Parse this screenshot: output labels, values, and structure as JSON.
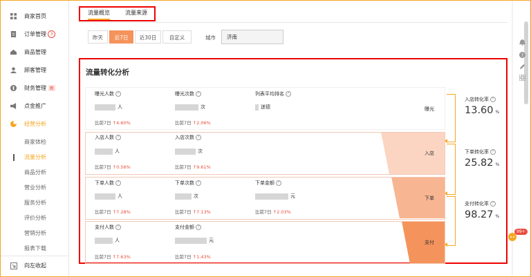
{
  "sidebar": {
    "items": [
      {
        "label": "商家首页",
        "icon": "grid-icon"
      },
      {
        "label": "订单管理",
        "icon": "order-icon",
        "badge": "3"
      },
      {
        "label": "商品管理",
        "icon": "goods-icon"
      },
      {
        "label": "顾客管理",
        "icon": "user-icon"
      },
      {
        "label": "财务管理",
        "icon": "finance-icon",
        "badge": "新"
      },
      {
        "label": "点金推广",
        "icon": "megaphone-icon"
      },
      {
        "label": "经营分析",
        "icon": "pie-chart-icon"
      }
    ],
    "subitems": [
      "商家体检",
      "流量分析",
      "商品分析",
      "营业分析",
      "服务分析",
      "评价分析",
      "营销分析",
      "报表下载"
    ],
    "collapse_label": "向左收起"
  },
  "tabs": [
    "流量概览",
    "流量来源"
  ],
  "date_filter": {
    "options": [
      "昨天",
      "近7日",
      "近30日",
      "自定义"
    ],
    "selected": "近7日"
  },
  "city": {
    "label": "城市",
    "value": "济南"
  },
  "panel": {
    "title": "流量转化分析",
    "rows": [
      {
        "funnel_label": "曝光",
        "metrics": [
          {
            "label": "曝光人数",
            "unit": "人",
            "compare_prefix": "比前7日",
            "compare": "4.60%"
          },
          {
            "label": "曝光次数",
            "unit": "次",
            "compare_prefix": "比前7日",
            "compare": "2.06%"
          },
          {
            "label": "列表平均排名",
            "unit": "迷德"
          }
        ]
      },
      {
        "funnel_label": "入店",
        "metrics": [
          {
            "label": "入店人数",
            "unit": "人",
            "compare_prefix": "比前7日",
            "compare": "0.56%"
          },
          {
            "label": "入店次数",
            "unit": "次",
            "compare_prefix": "比前7日",
            "compare": "9.61%"
          }
        ]
      },
      {
        "funnel_label": "下单",
        "metrics": [
          {
            "label": "下单人数",
            "unit": "人",
            "compare_prefix": "比前7日",
            "compare": "7.28%"
          },
          {
            "label": "下单次数",
            "unit": "次",
            "compare_prefix": "比前7日",
            "compare": "7.13%"
          },
          {
            "label": "下单金额",
            "unit": "元",
            "compare_prefix": "比前7日",
            "compare": "2.03%"
          }
        ]
      },
      {
        "funnel_label": "支付",
        "metrics": [
          {
            "label": "支付人数",
            "unit": "人",
            "compare_prefix": "比前7日",
            "compare": "7.63%"
          },
          {
            "label": "支付金额",
            "unit": "元",
            "compare_prefix": "比前7日",
            "compare": "1.43%"
          }
        ]
      }
    ],
    "rates": [
      {
        "label": "入店转化率",
        "value": "13.60",
        "unit": "%"
      },
      {
        "label": "下单转化率",
        "value": "25.82",
        "unit": "%"
      },
      {
        "label": "支付转化率",
        "value": "98.27",
        "unit": "%"
      }
    ]
  },
  "message_badge": "99+",
  "colors": {
    "accent": "#f5a623",
    "orange": "#f5935c",
    "red_highlight": "#ee0000",
    "increase": "#e84c3d"
  }
}
